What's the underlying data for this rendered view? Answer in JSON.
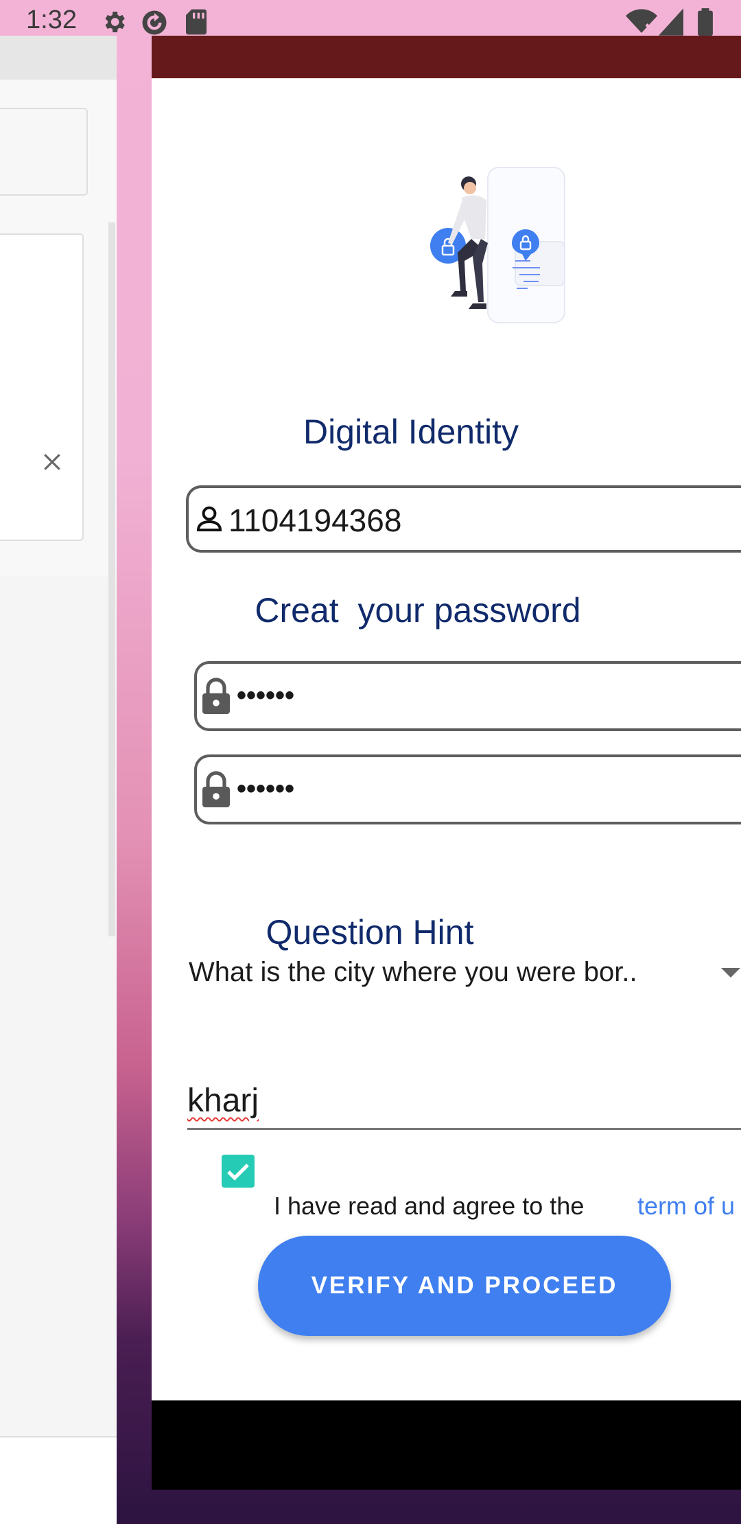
{
  "status_bar": {
    "time": "1:32",
    "icons": [
      "gear-icon",
      "sync-icon",
      "sd-card-icon",
      "wifi-off-icon",
      "signal-icon",
      "battery-icon"
    ]
  },
  "background_app": {
    "close_icon": "close-icon"
  },
  "form": {
    "digital_identity_title": "Digital Identity",
    "id_value": "1104194368",
    "password_title": "Creat  your password",
    "password_value": "••••••",
    "confirm_password_value": "••••••",
    "question_hint_title": "Question Hint",
    "question_selected": "What is the city where you were bor..",
    "answer_value": "kharj",
    "agree_checked": true,
    "agree_text": "I have read and agree to the",
    "terms_link": "term of u",
    "verify_button": "VERIFY AND PROCEED"
  },
  "colors": {
    "title": "#102a6b",
    "accent": "#3f7ff0",
    "checkbox": "#26cbb6",
    "topbar": "#66191b"
  }
}
